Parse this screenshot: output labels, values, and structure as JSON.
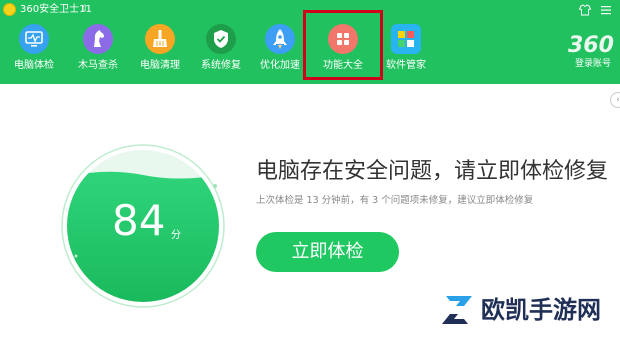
{
  "app": {
    "title": "360安全卫士11"
  },
  "window_controls": [
    {
      "name": "skin-icon",
      "glyph": "👕"
    },
    {
      "name": "menu-icon",
      "glyph": "☰"
    },
    {
      "name": "minimize-icon",
      "glyph": "—"
    },
    {
      "name": "close-icon",
      "glyph": "✕"
    }
  ],
  "nav": [
    {
      "label": "电脑体检",
      "icon": "monitor-check-icon",
      "color": "#37a2f0"
    },
    {
      "label": "木马查杀",
      "icon": "horse-icon",
      "color": "#8b6be8"
    },
    {
      "label": "电脑清理",
      "icon": "broom-icon",
      "color": "#f6a623"
    },
    {
      "label": "系统修复",
      "icon": "shield-icon",
      "color": "#1e9e4a"
    },
    {
      "label": "优化加速",
      "icon": "rocket-icon",
      "color": "#3d9ef5"
    },
    {
      "label": "功能大全",
      "icon": "grid-icon",
      "color": "#f2766a"
    },
    {
      "label": "软件管家",
      "icon": "apps-icon",
      "color": "#27b4f0"
    }
  ],
  "brand": {
    "logo_text": "360",
    "account_label": "登录账号"
  },
  "main": {
    "score": "84",
    "score_unit": "分",
    "headline": "电脑存在安全问题，请立即体检修复",
    "subtext": "上次体检是 13 分钟前，有 3 个问题项未修复，建议立即体检修复",
    "scan_button": "立即体检"
  },
  "watermark": {
    "text": "欧凯手游网"
  },
  "colors": {
    "header": "#22c160",
    "highlight": "#d0021b",
    "button": "#20c862"
  }
}
